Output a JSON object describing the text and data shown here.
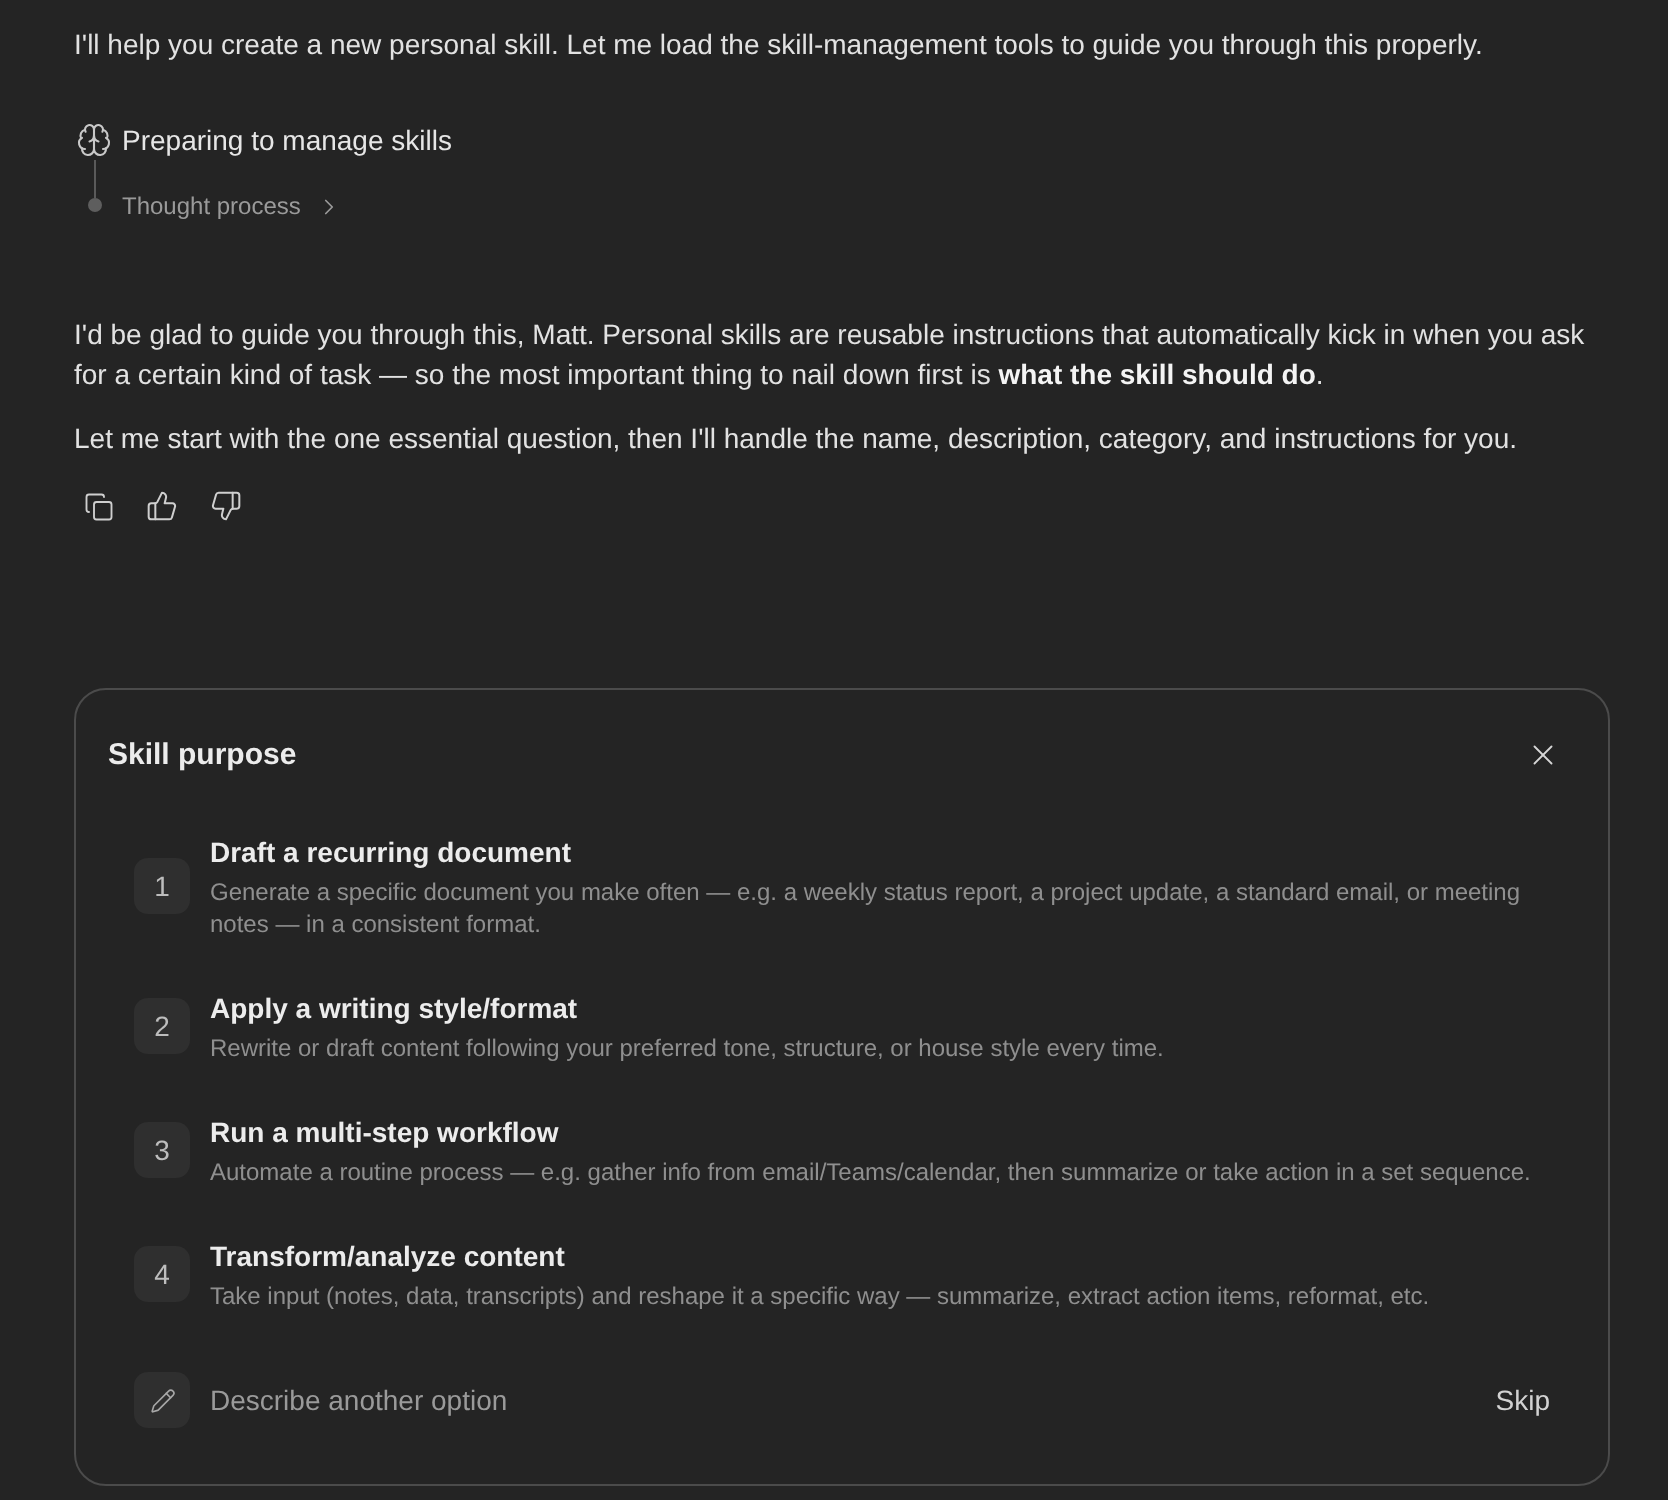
{
  "intro_message": {
    "text": "I'll help you create a new personal skill. Let me load the skill-management tools to guide you through this properly."
  },
  "thinking": {
    "title": "Preparing to manage skills",
    "toggle_label": "Thought process",
    "expanded": false
  },
  "reply": {
    "paragraphs": [
      "I'd be glad to guide you through this, Matt. Personal skills are reusable instructions that automatically kick in when you ask for a certain kind of task — so the most important thing to nail down first is **what the skill should do**.",
      "Let me start with the one essential question, then I'll handle the name, description, category, and instructions for you."
    ]
  },
  "question_card": {
    "title": "Skill purpose",
    "options": [
      {
        "number": "1",
        "title": "Draft a recurring document",
        "description": "Generate a specific document you make often — e.g. a weekly status report, a project update, a standard email, or meeting notes — in a consistent format."
      },
      {
        "number": "2",
        "title": "Apply a writing style/format",
        "description": "Rewrite or draft content following your preferred tone, structure, or house style every time."
      },
      {
        "number": "3",
        "title": "Run a multi-step workflow",
        "description": "Automate a routine process — e.g. gather info from email/Teams/calendar, then summarize or take action in a set sequence."
      },
      {
        "number": "4",
        "title": "Transform/analyze content",
        "description": "Take input (notes, data, transcripts) and reshape it a specific way — summarize, extract action items, reformat, etc."
      }
    ],
    "custom_option": {
      "placeholder": "Describe another option"
    },
    "skip_label": "Skip"
  }
}
